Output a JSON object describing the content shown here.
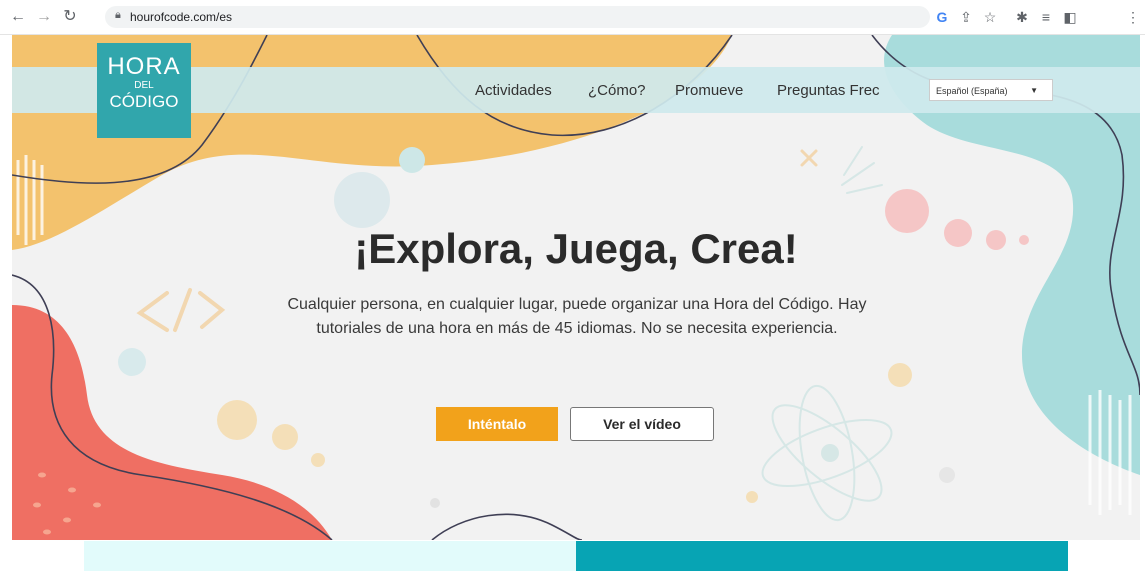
{
  "browser": {
    "url": "hourofcode.com/es",
    "icons": [
      "back-arrow-icon",
      "forward-arrow-icon",
      "reload-icon",
      "lock-icon",
      "google-icon",
      "share-icon",
      "star-icon",
      "extensions-icon",
      "reading-list-icon",
      "side-panel-icon",
      "more-icon"
    ]
  },
  "logo": {
    "line1": "HORA",
    "line2": "DEL",
    "line3": "CÓDIGO"
  },
  "nav": {
    "links": [
      "Actividades",
      "¿Cómo?",
      "Promueve",
      "Preguntas Frec"
    ],
    "language": "Español (España)"
  },
  "hero": {
    "title": "¡Explora, Juega, Crea!",
    "text": "Cualquier persona, en cualquier lugar, puede organizar una Hora del Código. Hay tutoriales de una hora en más de 45 idiomas. No se necesita experiencia.",
    "primary_button": "Inténtalo",
    "secondary_button": "Ver el vídeo"
  },
  "colors": {
    "orange": "#f2a21b",
    "teal": "#31a6ac",
    "coral": "#ef6f63",
    "mint": "#a8dcdc",
    "yellow_blob": "#f3c26d"
  }
}
